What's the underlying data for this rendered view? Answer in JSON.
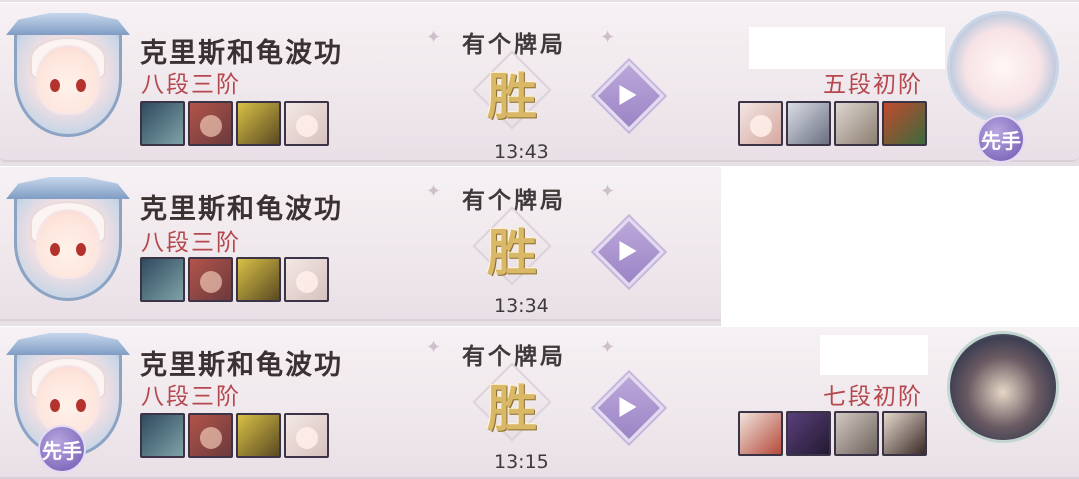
{
  "matches": [
    {
      "player_name": "克里斯和龟波功",
      "player_rank": "八段三阶",
      "player_first_badge": "",
      "mode": "有个牌局",
      "result": "胜",
      "time": "13:43",
      "opponent_rank": "五段初阶",
      "opponent_first_badge": "先手"
    },
    {
      "player_name": "克里斯和龟波功",
      "player_rank": "八段三阶",
      "player_first_badge": "",
      "mode": "有个牌局",
      "result": "胜",
      "time": "13:34",
      "opponent_rank": "",
      "opponent_first_badge": ""
    },
    {
      "player_name": "克里斯和龟波功",
      "player_rank": "八段三阶",
      "player_first_badge": "先手",
      "mode": "有个牌局",
      "result": "胜",
      "time": "13:15",
      "opponent_rank": "七段初阶",
      "opponent_first_badge": ""
    }
  ],
  "colors": {
    "rank": "#b5474d",
    "win": "#d9b867",
    "play_button": "#a58ecb"
  },
  "icons": {
    "play": "play-triangle-icon",
    "sparkle": "sparkle-icon"
  }
}
